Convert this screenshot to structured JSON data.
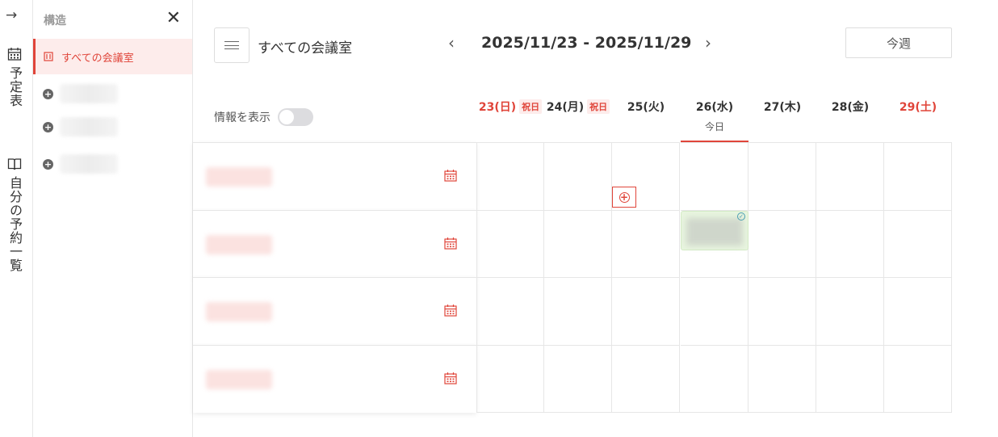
{
  "rail": {
    "expand_icon": "→",
    "nav": [
      {
        "label": "予定表",
        "icon": "calendar-icon"
      },
      {
        "label": "自分の予約一覧",
        "icon": "book-icon"
      }
    ]
  },
  "panel": {
    "title": "構造",
    "close_icon": "✕",
    "selected": {
      "label": "すべての会議室",
      "icon": "building-icon"
    },
    "groups": [
      {
        "icon": "plus-icon"
      },
      {
        "icon": "plus-icon"
      },
      {
        "icon": "plus-icon"
      }
    ]
  },
  "toolbar": {
    "room_title": "すべての会議室",
    "prev": "‹",
    "next": "›",
    "date_range": "2025/11/23 - 2025/11/29",
    "this_week": "今週"
  },
  "info_toggle": {
    "label": "情報を表示",
    "on": false
  },
  "days": [
    {
      "label": "23(日)",
      "holiday": "祝日",
      "red": true
    },
    {
      "label": "24(月)",
      "holiday": "祝日",
      "red": false
    },
    {
      "label": "25(火)",
      "holiday": "",
      "red": false
    },
    {
      "label": "26(水)",
      "holiday": "",
      "red": false,
      "today": "今日"
    },
    {
      "label": "27(木)",
      "holiday": "",
      "red": false
    },
    {
      "label": "28(金)",
      "holiday": "",
      "red": false
    },
    {
      "label": "29(土)",
      "holiday": "",
      "red": true
    }
  ],
  "rooms": [
    {
      "icon": "calendar-icon"
    },
    {
      "icon": "calendar-icon"
    },
    {
      "icon": "calendar-icon"
    },
    {
      "icon": "calendar-icon"
    }
  ],
  "add_icon": "+",
  "event_status_icon": "check-icon",
  "colors": {
    "accent": "#e0453a",
    "event_bg": "#e8f5df",
    "holiday_bg": "#fdeceb"
  }
}
